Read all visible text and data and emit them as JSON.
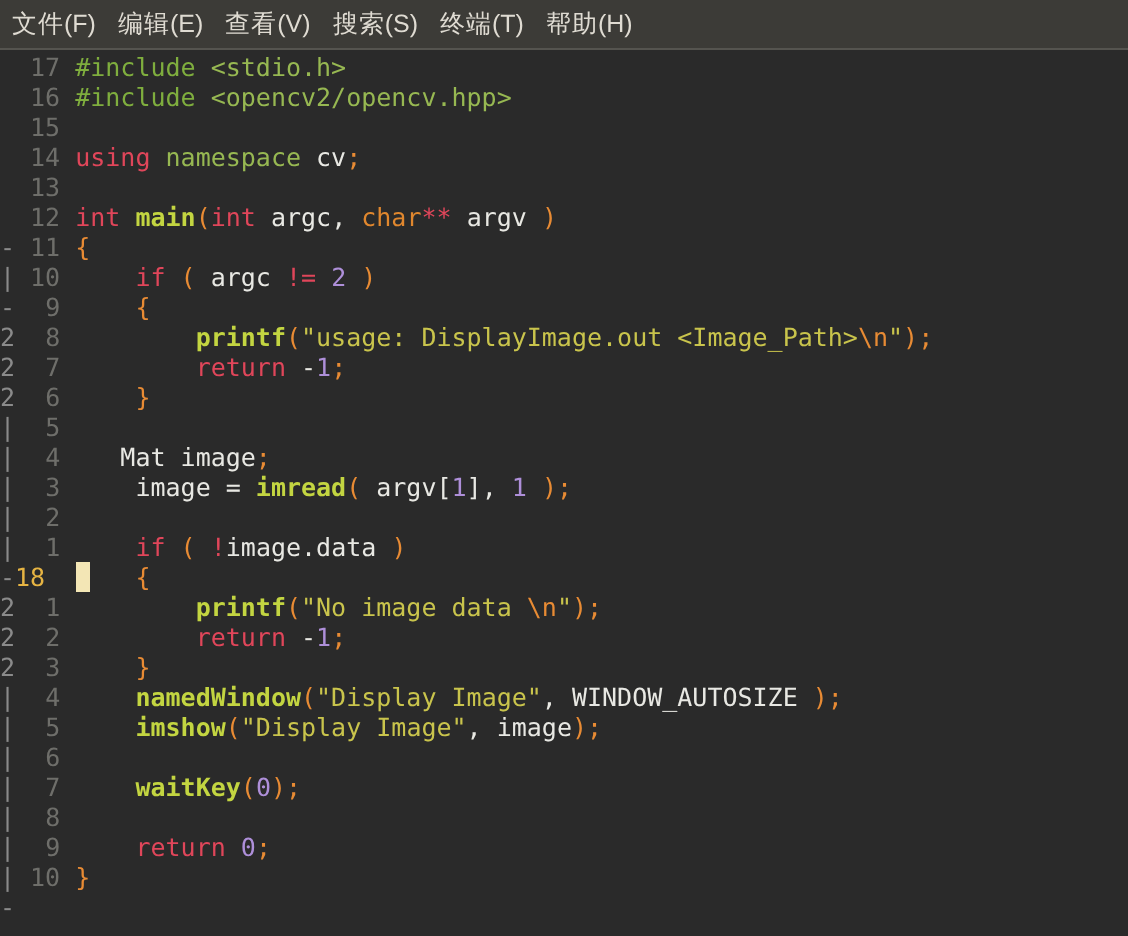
{
  "menu_bar": [
    {
      "label": "文件(F)"
    },
    {
      "label": "编辑(E)"
    },
    {
      "label": "查看(V)"
    },
    {
      "label": "搜索(S)"
    },
    {
      "label": "终端(T)"
    },
    {
      "label": "帮助(H)"
    }
  ],
  "editor": {
    "lines": [
      {
        "number": "17",
        "current": false,
        "tokens": [
          {
            "kind": "pre",
            "text": "#include "
          },
          {
            "kind": "inc",
            "text": "<stdio.h>"
          }
        ]
      },
      {
        "number": "16",
        "current": false,
        "tokens": [
          {
            "kind": "pre",
            "text": "#include "
          },
          {
            "kind": "inc",
            "text": "<opencv2/opencv.hpp>"
          }
        ]
      },
      {
        "number": "15",
        "current": false
      },
      {
        "number": "14",
        "current": false,
        "tokens": [
          {
            "kind": "kw",
            "text": "using "
          },
          {
            "kind": "inc",
            "text": "namespace"
          },
          {
            "kind": "plain",
            "text": " cv"
          },
          {
            "kind": "punc",
            "text": ";"
          }
        ]
      },
      {
        "number": "13",
        "current": false
      },
      {
        "number": "12",
        "current": false,
        "tokens": [
          {
            "kind": "kw",
            "text": "int "
          },
          {
            "kind": "fn",
            "text": "main"
          },
          {
            "kind": "punc",
            "text": "("
          },
          {
            "kind": "kw",
            "text": "int"
          },
          {
            "kind": "plain",
            "text": " argc, "
          },
          {
            "kind": "type",
            "text": "char"
          },
          {
            "kind": "op",
            "text": "**"
          },
          {
            "kind": "plain",
            "text": " argv "
          },
          {
            "kind": "punc",
            "text": ")"
          }
        ]
      },
      {
        "fold": "-",
        "number": "11",
        "current": false,
        "tokens": [
          {
            "kind": "punc",
            "text": "{"
          }
        ]
      },
      {
        "fold": "|",
        "number": "10",
        "current": false,
        "tokens": [
          {
            "kind": "kw",
            "text": "    if "
          },
          {
            "kind": "punc",
            "text": "("
          },
          {
            "kind": "plain",
            "text": " argc "
          },
          {
            "kind": "op",
            "text": "!= "
          },
          {
            "kind": "num",
            "text": "2 "
          },
          {
            "kind": "punc",
            "text": ")"
          }
        ]
      },
      {
        "fold": "-",
        "number": "9",
        "current": false,
        "tokens": [
          {
            "kind": "punc",
            "text": "    {"
          }
        ]
      },
      {
        "fold": "2",
        "number": "8",
        "current": false,
        "tokens": [
          {
            "kind": "fn",
            "text": "        printf"
          },
          {
            "kind": "punc",
            "text": "("
          },
          {
            "kind": "str",
            "text": "\"usage: DisplayImage.out <Image_Path>"
          },
          {
            "kind": "esc",
            "text": "\\n"
          },
          {
            "kind": "str",
            "text": "\""
          },
          {
            "kind": "punc",
            "text": ");"
          }
        ]
      },
      {
        "fold": "2",
        "number": "7",
        "current": false,
        "tokens": [
          {
            "kind": "kw",
            "text": "        return"
          },
          {
            "kind": "plain",
            "text": " -"
          },
          {
            "kind": "num",
            "text": "1"
          },
          {
            "kind": "punc",
            "text": ";"
          }
        ]
      },
      {
        "fold": "2",
        "number": "6",
        "current": false,
        "tokens": [
          {
            "kind": "punc",
            "text": "    }"
          }
        ]
      },
      {
        "fold": "|",
        "number": "5",
        "current": false
      },
      {
        "fold": "|",
        "number": "4",
        "current": false,
        "tokens": [
          {
            "kind": "plain",
            "text": "   Mat image"
          },
          {
            "kind": "punc",
            "text": ";"
          }
        ]
      },
      {
        "fold": "|",
        "number": "3",
        "current": false,
        "tokens": [
          {
            "kind": "plain",
            "text": "    image = "
          },
          {
            "kind": "fn",
            "text": "imread"
          },
          {
            "kind": "punc",
            "text": "("
          },
          {
            "kind": "plain",
            "text": " argv["
          },
          {
            "kind": "num",
            "text": "1"
          },
          {
            "kind": "plain",
            "text": "], "
          },
          {
            "kind": "num",
            "text": "1 "
          },
          {
            "kind": "punc",
            "text": ");"
          }
        ]
      },
      {
        "fold": "|",
        "number": "2",
        "current": false
      },
      {
        "fold": "|",
        "number": "1",
        "current": false,
        "tokens": [
          {
            "kind": "kw",
            "text": "    if "
          },
          {
            "kind": "punc",
            "text": "( "
          },
          {
            "kind": "op",
            "text": "!"
          },
          {
            "kind": "plain",
            "text": "image.data "
          },
          {
            "kind": "punc",
            "text": ")"
          }
        ]
      },
      {
        "fold": "-",
        "number": "18",
        "current": true,
        "tokens": [
          {
            "kind": "punc",
            "text": "    {"
          }
        ]
      },
      {
        "fold": "2",
        "number": "1",
        "current": false,
        "tokens": [
          {
            "kind": "fn",
            "text": "        printf"
          },
          {
            "kind": "punc",
            "text": "("
          },
          {
            "kind": "str",
            "text": "\"No image data "
          },
          {
            "kind": "esc",
            "text": "\\n"
          },
          {
            "kind": "str",
            "text": "\""
          },
          {
            "kind": "punc",
            "text": ");"
          }
        ]
      },
      {
        "fold": "2",
        "number": "2",
        "current": false,
        "tokens": [
          {
            "kind": "kw",
            "text": "        return"
          },
          {
            "kind": "plain",
            "text": " -"
          },
          {
            "kind": "num",
            "text": "1"
          },
          {
            "kind": "punc",
            "text": ";"
          }
        ]
      },
      {
        "fold": "2",
        "number": "3",
        "current": false,
        "tokens": [
          {
            "kind": "punc",
            "text": "    }"
          }
        ]
      },
      {
        "fold": "|",
        "number": "4",
        "current": false,
        "tokens": [
          {
            "kind": "fn",
            "text": "    namedWindow"
          },
          {
            "kind": "punc",
            "text": "("
          },
          {
            "kind": "str",
            "text": "\"Display Image\""
          },
          {
            "kind": "plain",
            "text": ", WINDOW_AUTOSIZE "
          },
          {
            "kind": "punc",
            "text": ");"
          }
        ]
      },
      {
        "fold": "|",
        "number": "5",
        "current": false,
        "tokens": [
          {
            "kind": "fn",
            "text": "    imshow"
          },
          {
            "kind": "punc",
            "text": "("
          },
          {
            "kind": "str",
            "text": "\"Display Image\""
          },
          {
            "kind": "plain",
            "text": ", image"
          },
          {
            "kind": "punc",
            "text": ");"
          }
        ]
      },
      {
        "fold": "|",
        "number": "6",
        "current": false
      },
      {
        "fold": "|",
        "number": "7",
        "current": false,
        "tokens": [
          {
            "kind": "fn",
            "text": "    waitKey"
          },
          {
            "kind": "punc",
            "text": "("
          },
          {
            "kind": "num",
            "text": "0"
          },
          {
            "kind": "punc",
            "text": ");"
          }
        ]
      },
      {
        "fold": "|",
        "number": "8",
        "current": false
      },
      {
        "fold": "|",
        "number": "9",
        "current": false,
        "tokens": [
          {
            "kind": "kw",
            "text": "    return "
          },
          {
            "kind": "num",
            "text": "0"
          },
          {
            "kind": "punc",
            "text": ";"
          }
        ]
      },
      {
        "fold": "|",
        "number": "10",
        "current": false,
        "tokens": [
          {
            "kind": "punc",
            "text": "}"
          }
        ]
      },
      {
        "fold": "-"
      }
    ]
  }
}
